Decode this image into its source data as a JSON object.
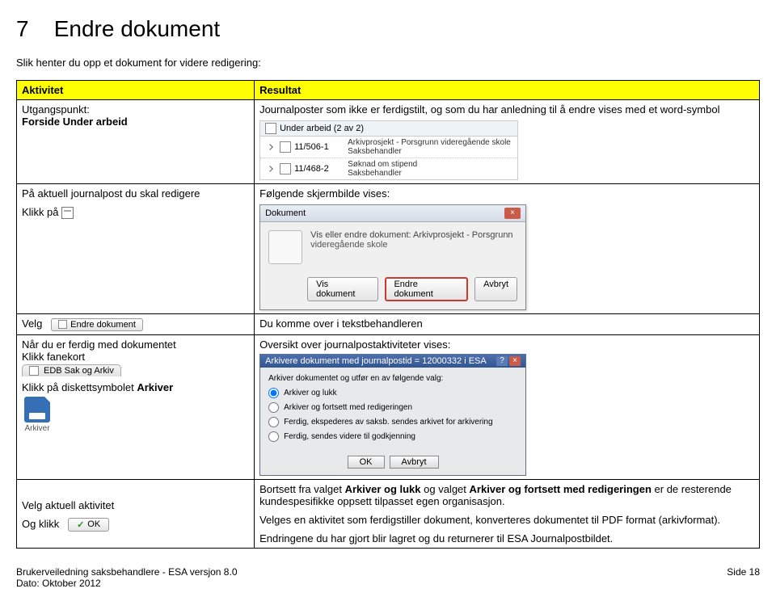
{
  "section_number": "7",
  "section_title": "Endre dokument",
  "intro_text": "Slik henter du opp et dokument for videre redigering:",
  "table": {
    "header_left": "Aktivitet",
    "header_right": "Resultat",
    "row1": {
      "left_line1": "Utgangspunkt:",
      "left_line2": "Forside Under arbeid",
      "right_text": "Journalposter som ikke er ferdigstilt, og som du har anledning til å endre vises med et word-symbol",
      "ss_tab": "Under arbeid (2 av 2)",
      "ss_r1_c1": "11/506-1",
      "ss_r1_c2a": "Arkivprosjekt - Porsgrunn videregående skole",
      "ss_r1_c2b": "Saksbehandler",
      "ss_r2_c1": "11/468-2",
      "ss_r2_c2a": "Søknad om stipend",
      "ss_r2_c2b": "Saksbehandler"
    },
    "row2": {
      "left_line1": "På aktuell journalpost du skal redigere",
      "left_line2": "Klikk på",
      "right_text": "Følgende skjermbilde vises:",
      "dlg_title": "Dokument",
      "dlg_t1": "Vis eller endre dokument: Arkivprosjekt - Porsgrunn",
      "dlg_t2": "videregående skole",
      "btn_vis": "Vis dokument",
      "btn_endre": "Endre dokument",
      "btn_avbryt": "Avbryt"
    },
    "row3": {
      "left_text": "Velg",
      "endre_btn_label": "Endre dokument",
      "right_text": "Du komme over i tekstbehandleren"
    },
    "row4": {
      "left_line1": "Når du er ferdig med dokumentet",
      "left_line2": "Klikk fanekort",
      "fanekort_label": "EDB Sak og Arkiv",
      "left_line3_a": "Klikk på diskettsymbolet ",
      "left_line3_b": "Arkiver",
      "disk_label": "Arkiver",
      "right_text": "Oversikt over journalpostaktiviteter vises:",
      "arch_title": "Arkivere dokument med journalpostid = 12000332 i ESA",
      "arch_lbl": "Arkiver dokumentet og utfør en av følgende valg:",
      "arch_o1": "Arkiver og lukk",
      "arch_o2": "Arkiver og fortsett med redigeringen",
      "arch_o3": "Ferdig, ekspederes av saksb. sendes arkivet for arkivering",
      "arch_o4": "Ferdig, sendes videre til godkjenning",
      "arch_ok": "OK",
      "arch_cancel": "Avbryt"
    },
    "row5": {
      "left_line1": "Velg aktuell aktivitet",
      "left_line2": "Og klikk",
      "ok_label": "OK",
      "right_p1a": "Bortsett fra valget ",
      "right_p1b": "Arkiver og lukk",
      "right_p1c": " og valget ",
      "right_p1d": "Arkiver og fortsett med redigeringen",
      "right_p1e": " er de resterende kundespesifikke oppsett tilpasset egen organisasjon.",
      "right_p2": "Velges en aktivitet som ferdigstiller dokument, konverteres dokumentet til PDF format (arkivformat).",
      "right_p3": "Endringene du har gjort blir lagret og du returnerer til ESA Journalpostbildet."
    }
  },
  "footer": {
    "left_line1": "Brukerveiledning saksbehandlere - ESA versjon 8.0",
    "left_line2": "Dato: Oktober 2012",
    "right": "Side 18"
  }
}
